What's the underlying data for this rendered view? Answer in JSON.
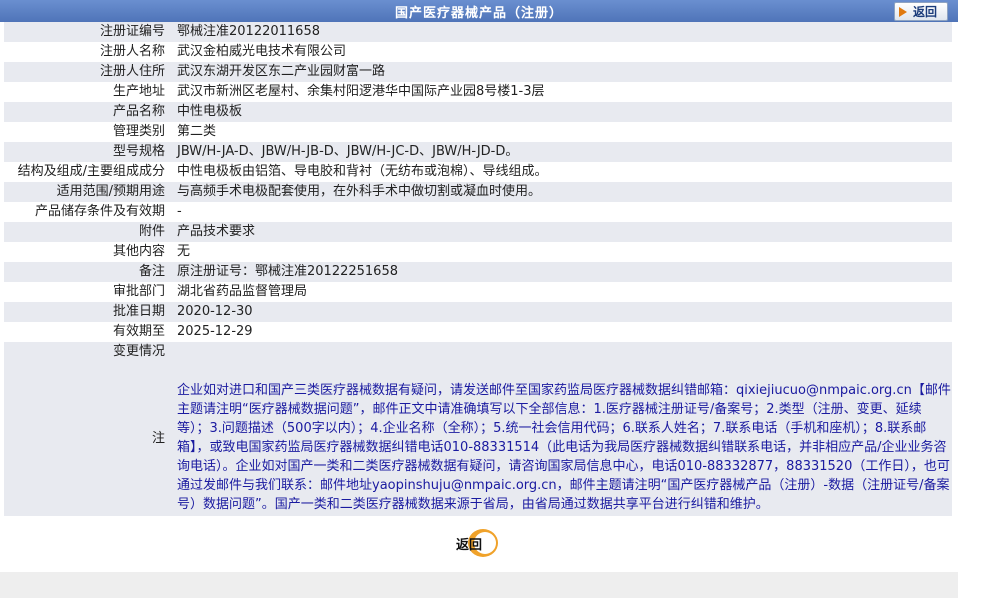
{
  "header": {
    "title": "国产医疗器械产品（注册）",
    "back_label": "返回"
  },
  "rows": [
    {
      "label": "注册证编号",
      "value": "鄂械注准20122011658"
    },
    {
      "label": "注册人名称",
      "value": "武汉金柏威光电技术有限公司"
    },
    {
      "label": "注册人住所",
      "value": "武汉东湖开发区东二产业园财富一路"
    },
    {
      "label": "生产地址",
      "value": "武汉市新洲区老屋村、余集村阳逻港华中国际产业园8号楼1-3层"
    },
    {
      "label": "产品名称",
      "value": "中性电极板"
    },
    {
      "label": "管理类别",
      "value": "第二类"
    },
    {
      "label": "型号规格",
      "value": "JBW/H-JA-D、JBW/H-JB-D、JBW/H-JC-D、JBW/H-JD-D。"
    },
    {
      "label": "结构及组成/主要组成成分",
      "value": "中性电极板由铝箔、导电胶和背衬（无纺布或泡棉）、导线组成。"
    },
    {
      "label": "适用范围/预期用途",
      "value": "与高频手术电极配套使用，在外科手术中做切割或凝血时使用。"
    },
    {
      "label": "产品储存条件及有效期",
      "value": "-"
    },
    {
      "label": "附件",
      "value": "产品技术要求"
    },
    {
      "label": "其他内容",
      "value": "无"
    },
    {
      "label": "备注",
      "value": "原注册证号：鄂械注准20122251658"
    },
    {
      "label": "审批部门",
      "value": "湖北省药品监督管理局"
    },
    {
      "label": "批准日期",
      "value": "2020-12-30"
    },
    {
      "label": "有效期至",
      "value": "2025-12-29"
    },
    {
      "label": "变更情况",
      "value": ""
    }
  ],
  "note": {
    "label": "注",
    "text": "企业如对进口和国产三类医疗器械数据有疑问，请发送邮件至国家药监局医疗器械数据纠错邮箱：qixiejiucuo@nmpaic.org.cn【邮件主题请注明“医疗器械数据问题”，邮件正文中请准确填写以下全部信息：1.医疗器械注册证号/备案号；2.类型（注册、变更、延续等）；3.问题描述（500字以内）；4.企业名称（全称）；5.统一社会信用代码；6.联系人姓名；7.联系电话（手机和座机）；8.联系邮箱】，或致电国家药监局医疗器械数据纠错电话010-88331514（此电话为我局医疗器械数据纠错联系电话，并非相应产品/企业业务咨询电话）。企业如对国产一类和二类医疗器械数据有疑问，请咨询国家局信息中心，电话010-88332877，88331520（工作日），也可通过发邮件与我们联系：邮件地址yaopinshuju@nmpaic.org.cn，邮件主题请注明“国产医疗器械产品（注册）-数据（注册证号/备案号）数据问题”。国产一类和二类医疗器械数据来源于省局，由省局通过数据共享平台进行纠错和维护。"
  },
  "footer": {
    "back_label": "返回"
  }
}
